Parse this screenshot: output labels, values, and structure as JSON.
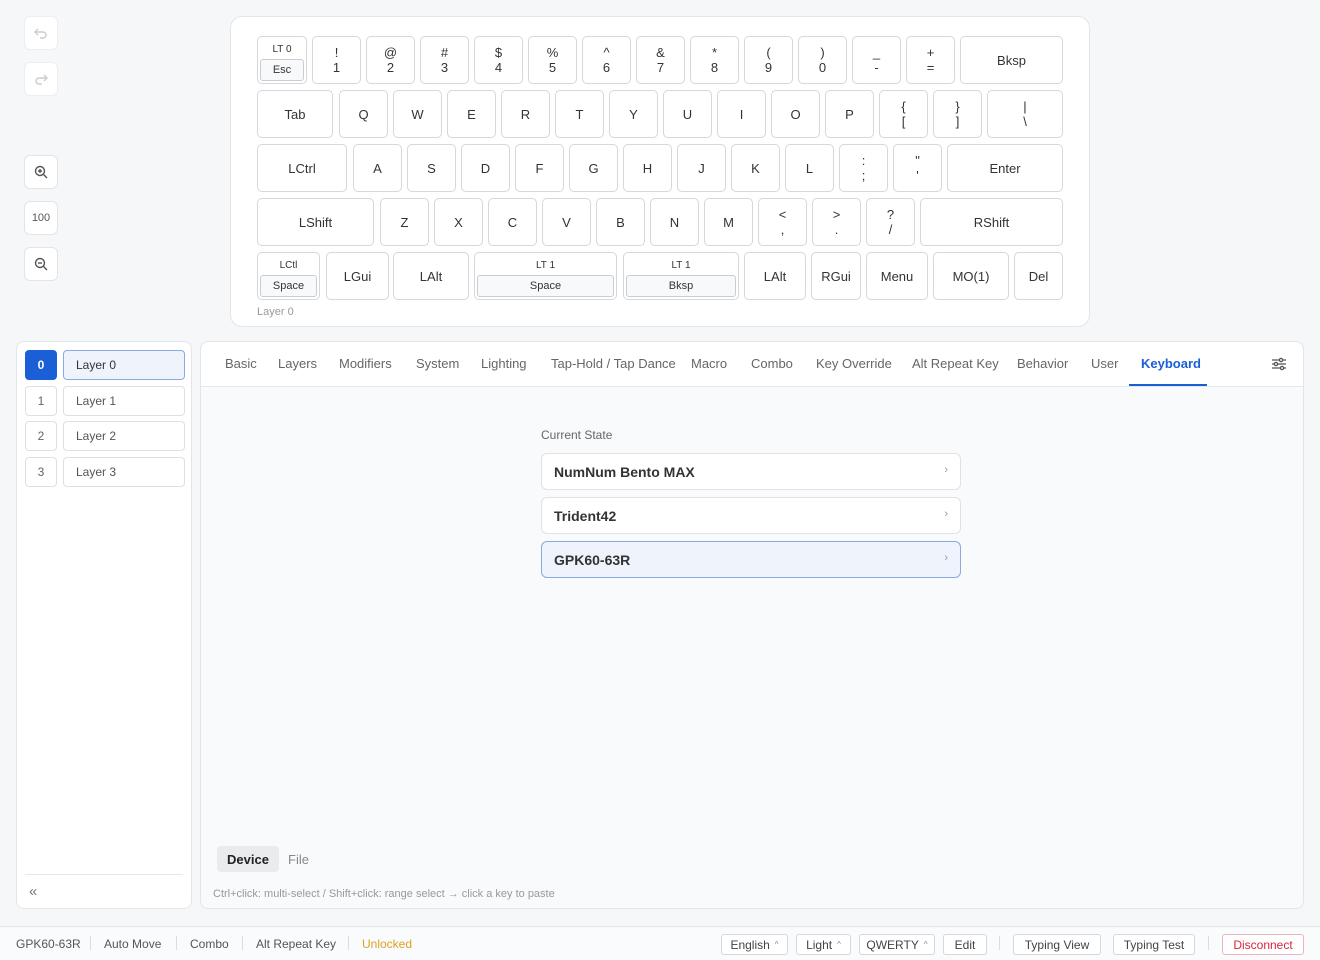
{
  "tools": {
    "undo_icon": "undo-icon",
    "redo_icon": "redo-icon",
    "zoom_in_icon": "zoom-in-icon",
    "zoom_level": "100",
    "zoom_out_icon": "zoom-out-icon"
  },
  "keyboard": {
    "layer_label": "Layer 0",
    "rows": [
      [
        {
          "top": "LT 0",
          "inner": "Esc"
        },
        {
          "top": "!",
          "sub": "1"
        },
        {
          "top": "@",
          "sub": "2"
        },
        {
          "top": "#",
          "sub": "3"
        },
        {
          "top": "$",
          "sub": "4"
        },
        {
          "top": "%",
          "sub": "5"
        },
        {
          "top": "^",
          "sub": "6"
        },
        {
          "top": "&",
          "sub": "7"
        },
        {
          "top": "*",
          "sub": "8"
        },
        {
          "top": "(",
          "sub": "9"
        },
        {
          "top": ")",
          "sub": "0"
        },
        {
          "top": "_",
          "sub": "-"
        },
        {
          "top": "+",
          "sub": "="
        },
        {
          "label": "Bksp"
        }
      ],
      [
        {
          "label": "Tab"
        },
        {
          "label": "Q"
        },
        {
          "label": "W"
        },
        {
          "label": "E"
        },
        {
          "label": "R"
        },
        {
          "label": "T"
        },
        {
          "label": "Y"
        },
        {
          "label": "U"
        },
        {
          "label": "I"
        },
        {
          "label": "O"
        },
        {
          "label": "P"
        },
        {
          "top": "{",
          "sub": "["
        },
        {
          "top": "}",
          "sub": "]"
        },
        {
          "top": "|",
          "sub": "\\"
        }
      ],
      [
        {
          "label": "LCtrl"
        },
        {
          "label": "A"
        },
        {
          "label": "S"
        },
        {
          "label": "D"
        },
        {
          "label": "F"
        },
        {
          "label": "G"
        },
        {
          "label": "H"
        },
        {
          "label": "J"
        },
        {
          "label": "K"
        },
        {
          "label": "L"
        },
        {
          "top": ":",
          "sub": ";"
        },
        {
          "top": "\"",
          "sub": "'"
        },
        {
          "label": "Enter"
        }
      ],
      [
        {
          "label": "LShift"
        },
        {
          "label": "Z"
        },
        {
          "label": "X"
        },
        {
          "label": "C"
        },
        {
          "label": "V"
        },
        {
          "label": "B"
        },
        {
          "label": "N"
        },
        {
          "label": "M"
        },
        {
          "top": "<",
          "sub": ","
        },
        {
          "top": ">",
          "sub": "."
        },
        {
          "top": "?",
          "sub": "/"
        },
        {
          "label": "RShift"
        }
      ],
      [
        {
          "top": "LCtl",
          "inner": "Space"
        },
        {
          "label": "LGui"
        },
        {
          "label": "LAlt"
        },
        {
          "top": "LT 1",
          "inner": "Space"
        },
        {
          "top": "LT 1",
          "inner": "Bksp"
        },
        {
          "label": "LAlt"
        },
        {
          "label": "RGui"
        },
        {
          "label": "Menu"
        },
        {
          "label": "MO(1)"
        },
        {
          "label": "Del"
        }
      ]
    ]
  },
  "layers": [
    {
      "num": "0",
      "name": "Layer 0",
      "active": true
    },
    {
      "num": "1",
      "name": "Layer 1",
      "active": false
    },
    {
      "num": "2",
      "name": "Layer 2",
      "active": false
    },
    {
      "num": "3",
      "name": "Layer 3",
      "active": false
    }
  ],
  "collapse_label": "«",
  "tabs": [
    "Basic",
    "Layers",
    "Modifiers",
    "System",
    "Lighting",
    "Tap-Hold / Tap Dance",
    "Macro",
    "Combo",
    "Key Override",
    "Alt Repeat Key",
    "Behavior",
    "User",
    "Keyboard"
  ],
  "active_tab": "Keyboard",
  "settings_icon": "sliders-icon",
  "keyboard_tab": {
    "section_label": "Current State",
    "items": [
      {
        "name": "NumNum Bento MAX",
        "active": false
      },
      {
        "name": "Trident42",
        "active": false
      },
      {
        "name": "GPK60-63R",
        "active": true
      }
    ],
    "chevron": "›",
    "source_tabs": [
      "Device",
      "File"
    ],
    "active_source": "Device",
    "hint": "Ctrl+click: multi-select / Shift+click: range select → click a key to paste"
  },
  "statusbar": {
    "device": "GPK60-63R",
    "auto_move": "Auto Move",
    "combo": "Combo",
    "alt_repeat": "Alt Repeat Key",
    "lock_state": "Unlocked",
    "lock_color": "#e0a021",
    "language": "English",
    "theme": "Light",
    "layout": "QWERTY",
    "edit": "Edit",
    "typing_view": "Typing View",
    "typing_test": "Typing Test",
    "disconnect": "Disconnect",
    "caret": "^"
  },
  "colors": {
    "accent": "#1a5fd6",
    "danger": "#d7263d"
  }
}
